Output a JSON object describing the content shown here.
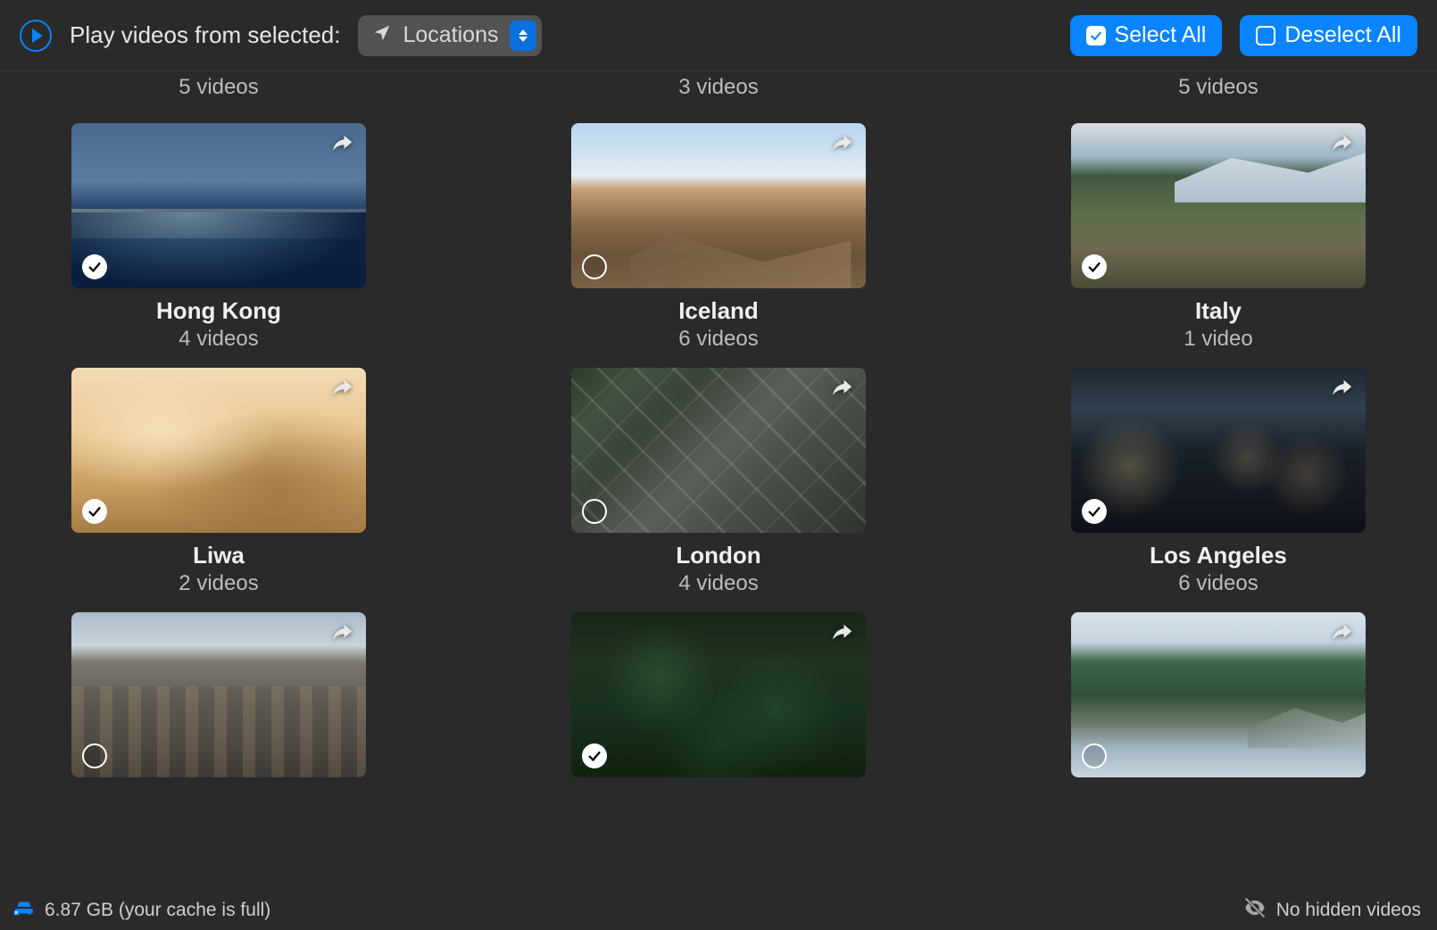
{
  "toolbar": {
    "play_label": "Play videos from selected:",
    "dropdown_label": "Locations",
    "select_all_label": "Select All",
    "deselect_all_label": "Deselect All"
  },
  "partial_row_counts": [
    "5 videos",
    "3 videos",
    "5 videos"
  ],
  "locations": [
    {
      "name": "Hong Kong",
      "count": "4 videos",
      "selected": true,
      "scene": "scene-hongkong"
    },
    {
      "name": "Iceland",
      "count": "6 videos",
      "selected": false,
      "scene": "scene-iceland"
    },
    {
      "name": "Italy",
      "count": "1 video",
      "selected": true,
      "scene": "scene-italy"
    },
    {
      "name": "Liwa",
      "count": "2 videos",
      "selected": true,
      "scene": "scene-liwa"
    },
    {
      "name": "London",
      "count": "4 videos",
      "selected": false,
      "scene": "scene-london"
    },
    {
      "name": "Los Angeles",
      "count": "6 videos",
      "selected": true,
      "scene": "scene-losangeles"
    },
    {
      "name": "",
      "count": "",
      "selected": false,
      "scene": "scene-vegas"
    },
    {
      "name": "",
      "count": "",
      "selected": true,
      "scene": "scene-forest"
    },
    {
      "name": "",
      "count": "",
      "selected": false,
      "scene": "scene-coast"
    }
  ],
  "status": {
    "cache_text": "6.87 GB (your cache is full)",
    "hidden_text": "No hidden videos"
  },
  "colors": {
    "accent": "#0a84ff",
    "background": "#2a2a2a"
  }
}
